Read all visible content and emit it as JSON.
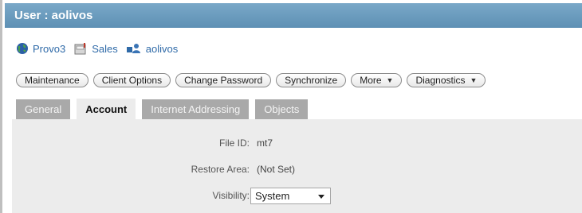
{
  "window": {
    "title": "User : aolivos"
  },
  "breadcrumb": {
    "items": [
      {
        "label": "Provo3",
        "icon": "globe-icon"
      },
      {
        "label": "Sales",
        "icon": "post-office-icon"
      },
      {
        "label": "aolivos",
        "icon": "user-icon"
      }
    ]
  },
  "toolbar": {
    "buttons": [
      {
        "label": "Maintenance"
      },
      {
        "label": "Client Options"
      },
      {
        "label": "Change Password"
      },
      {
        "label": "Synchronize"
      },
      {
        "label": "More",
        "dropdown": true
      },
      {
        "label": "Diagnostics",
        "dropdown": true
      }
    ]
  },
  "tabs": [
    {
      "label": "General",
      "active": false
    },
    {
      "label": "Account",
      "active": true
    },
    {
      "label": "Internet Addressing",
      "active": false
    },
    {
      "label": "Objects",
      "active": false
    }
  ],
  "form": {
    "file_id": {
      "label": "File ID:",
      "value": "mt7"
    },
    "restore_area": {
      "label": "Restore Area:",
      "value": "(Not Set)"
    },
    "visibility": {
      "label": "Visibility:",
      "value": "System"
    }
  },
  "colors": {
    "title_bar": "#6a9cbf",
    "link": "#2f6aa8",
    "panel": "#ececec",
    "inactive_tab": "#a9a9a9"
  }
}
